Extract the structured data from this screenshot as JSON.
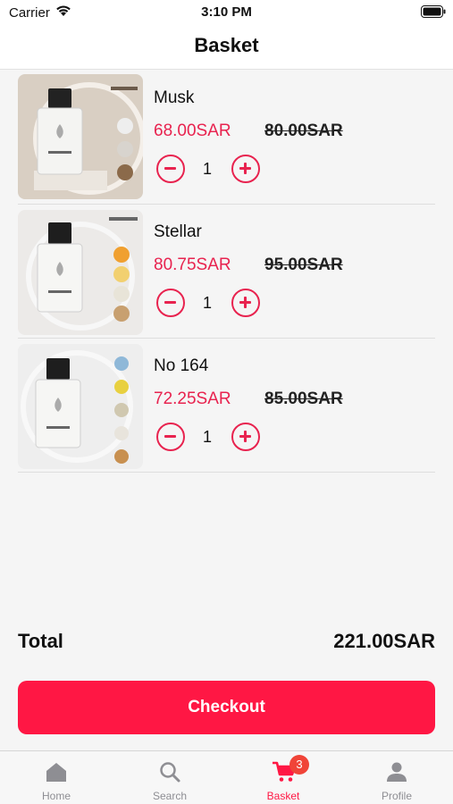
{
  "status_bar": {
    "carrier": "Carrier",
    "time": "3:10 PM"
  },
  "header": {
    "title": "Basket"
  },
  "cart_items": [
    {
      "name": "Musk",
      "price": "68.00SAR",
      "original_price": "80.00SAR",
      "quantity": "1"
    },
    {
      "name": "Stellar",
      "price": "80.75SAR",
      "original_price": "95.00SAR",
      "quantity": "1"
    },
    {
      "name": "No 164",
      "price": "72.25SAR",
      "original_price": "85.00SAR",
      "quantity": "1"
    }
  ],
  "summary": {
    "total_label": "Total",
    "total_value": "221.00SAR"
  },
  "checkout": {
    "label": "Checkout"
  },
  "tabs": [
    {
      "label": "Home",
      "icon": "home-icon"
    },
    {
      "label": "Search",
      "icon": "search-icon"
    },
    {
      "label": "Basket",
      "icon": "cart-icon",
      "badge": "3"
    },
    {
      "label": "Profile",
      "icon": "person-icon"
    }
  ],
  "colors": {
    "accent": "#ff1744",
    "price": "#e8234f",
    "inactive_tab": "#8e8e93"
  }
}
